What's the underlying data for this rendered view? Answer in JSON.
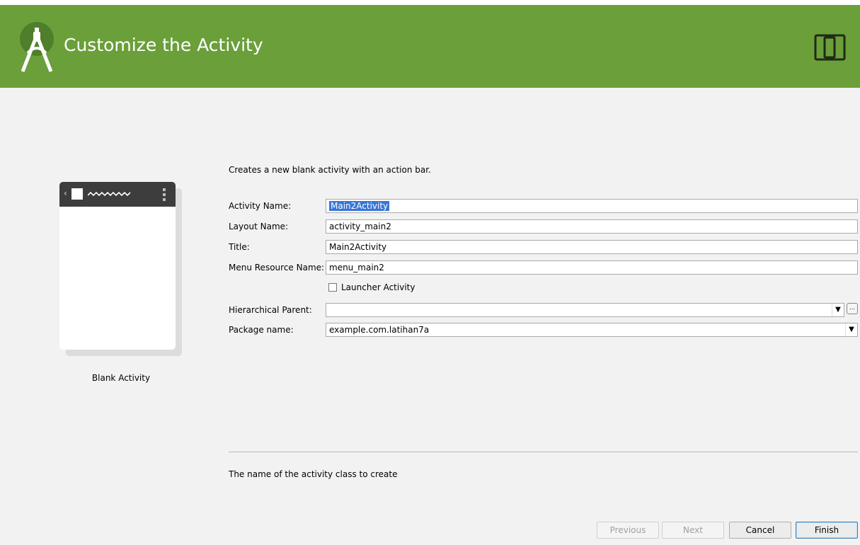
{
  "header": {
    "title": "Customize the Activity",
    "background": "#6a9f3a",
    "logo_icon": "android-studio-icon",
    "device_icon": "tablet-phone-icon"
  },
  "preview": {
    "label": "Blank Activity"
  },
  "description": "Creates a new blank activity with an action bar.",
  "form": {
    "activity_name": {
      "label": "Activity Name:",
      "value": "Main2Activity"
    },
    "layout_name": {
      "label": "Layout Name:",
      "value": "activity_main2"
    },
    "title": {
      "label": "Title:",
      "value": "Main2Activity"
    },
    "menu_resource_name": {
      "label": "Menu Resource Name:",
      "value": "menu_main2"
    },
    "launcher_activity": {
      "label": "Launcher Activity",
      "checked": false
    },
    "hierarchical_parent": {
      "label": "Hierarchical Parent:",
      "value": "",
      "browse_label": "..."
    },
    "package_name": {
      "label": "Package name:",
      "value": "example.com.latihan7a"
    }
  },
  "hint": "The name of the activity class to create",
  "buttons": {
    "previous": "Previous",
    "next": "Next",
    "cancel": "Cancel",
    "finish": "Finish"
  }
}
